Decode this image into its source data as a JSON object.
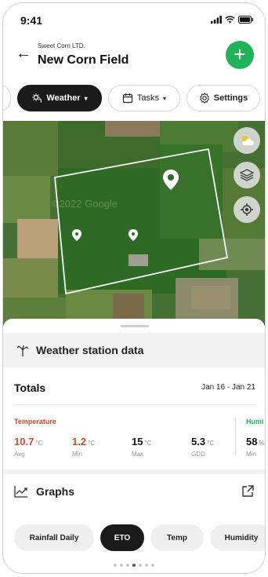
{
  "status_bar": {
    "time": "9:41"
  },
  "header": {
    "company": "Sweet Corn LTD.",
    "field_name": "New Corn Field",
    "add_label": "+"
  },
  "tabs": [
    {
      "label": "Weather",
      "active": true
    },
    {
      "label": "Tasks",
      "active": false
    },
    {
      "label": "Settings",
      "active": false
    }
  ],
  "map": {
    "watermark": "©2022 Google"
  },
  "panel": {
    "title": "Weather station data",
    "totals_label": "Totals",
    "date_range": "Jan 16 - Jan 21",
    "temperature": {
      "label": "Temperature",
      "stats": [
        {
          "value": "10.7",
          "unit": "°C",
          "label": "Avg"
        },
        {
          "value": "1.2",
          "unit": "°C",
          "label": "Min"
        },
        {
          "value": "15",
          "unit": "°C",
          "label": "Max"
        },
        {
          "value": "5.3",
          "unit": "°C",
          "label": "GDD"
        }
      ]
    },
    "humidity": {
      "label": "Humi",
      "value": "58",
      "unit": "%",
      "min_label": "Min"
    },
    "graphs_label": "Graphs",
    "chips": [
      {
        "label": "Rainfall Daily",
        "active": false
      },
      {
        "label": "ETO",
        "active": true
      },
      {
        "label": "Temp",
        "active": false
      },
      {
        "label": "Humidity",
        "active": false
      }
    ],
    "page_dots": {
      "count": 7,
      "active_index": 3
    }
  },
  "colors": {
    "accent_green": "#21b35a",
    "temp_red": "#d9452c",
    "dark": "#1a1a1a"
  }
}
